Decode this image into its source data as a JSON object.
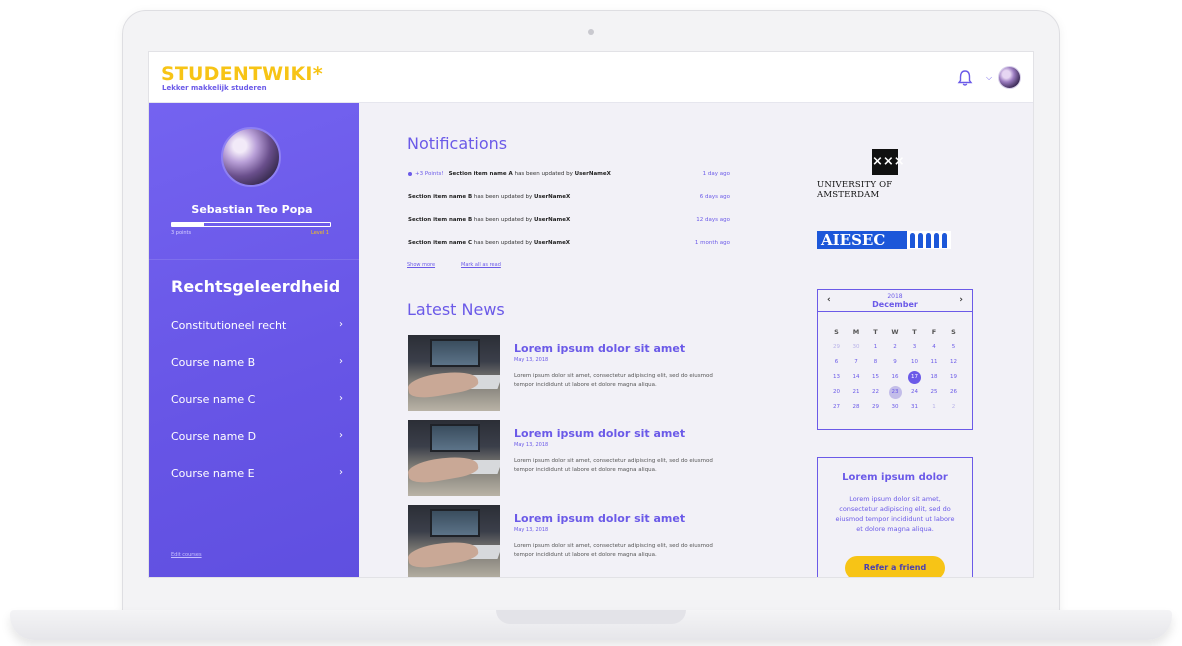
{
  "header": {
    "logo": "STUDENTWIKI*",
    "tagline": "Lekker makkelijk studeren"
  },
  "sidebar": {
    "user_name": "Sebastian Teo Popa",
    "points": "3 points",
    "level": "Level 1",
    "progress_fraction": 0.2,
    "faculty": "Rechtsgeleerdheid",
    "courses": [
      {
        "label": "Constitutioneel recht"
      },
      {
        "label": "Course name B"
      },
      {
        "label": "Course name C"
      },
      {
        "label": "Course name D"
      },
      {
        "label": "Course name E"
      }
    ],
    "edit_courses": "Edit courses"
  },
  "notifications": {
    "title": "Notifications",
    "items": [
      {
        "points": "+3 Points!",
        "item": "Section item name A",
        "text": "has been updated by",
        "user": "UserNameX",
        "time": "1 day ago"
      },
      {
        "points": "",
        "item": "Section item name B",
        "text": "has been updated by",
        "user": "UserNameX",
        "time": "6 days ago"
      },
      {
        "points": "",
        "item": "Section item name B",
        "text": "has been updated by",
        "user": "UserNameX",
        "time": "12 days ago"
      },
      {
        "points": "",
        "item": "Section item name C",
        "text": "has been updated by",
        "user": "UserNameX",
        "time": "1 month ago"
      }
    ],
    "show_more": "Show more",
    "mark_all_read": "Mark all as read"
  },
  "news": {
    "title": "Latest News",
    "items": [
      {
        "title": "Lorem ipsum dolor sit amet",
        "date": "May 13, 2018",
        "body": "Lorem ipsum dolor sit amet, consectetur adipiscing elit, sed do eiusmod tempor incididunt ut labore et dolore magna aliqua."
      },
      {
        "title": "Lorem ipsum dolor sit amet",
        "date": "May 13, 2018",
        "body": "Lorem ipsum dolor sit amet, consectetur adipiscing elit, sed do eiusmod tempor incididunt ut labore et dolore magna aliqua."
      },
      {
        "title": "Lorem ipsum dolor sit amet",
        "date": "May 13, 2018",
        "body": "Lorem ipsum dolor sit amet, consectetur adipiscing elit, sed do eiusmod tempor incididunt ut labore et dolore magna aliqua."
      }
    ]
  },
  "partners": {
    "uva_mark": "⨯⨯⨯",
    "uva_name": "UNIVERSITY OF AMSTERDAM",
    "aiesec_name": "AIESEC"
  },
  "calendar": {
    "year": "2018",
    "month": "December",
    "weekdays": [
      "S",
      "M",
      "T",
      "W",
      "T",
      "F",
      "S"
    ],
    "days": [
      {
        "d": "29",
        "s": "muted"
      },
      {
        "d": "30",
        "s": "muted"
      },
      {
        "d": "1",
        "s": ""
      },
      {
        "d": "2",
        "s": ""
      },
      {
        "d": "3",
        "s": ""
      },
      {
        "d": "4",
        "s": ""
      },
      {
        "d": "5",
        "s": ""
      },
      {
        "d": "6",
        "s": ""
      },
      {
        "d": "7",
        "s": ""
      },
      {
        "d": "8",
        "s": ""
      },
      {
        "d": "9",
        "s": ""
      },
      {
        "d": "10",
        "s": ""
      },
      {
        "d": "11",
        "s": ""
      },
      {
        "d": "12",
        "s": ""
      },
      {
        "d": "13",
        "s": ""
      },
      {
        "d": "14",
        "s": ""
      },
      {
        "d": "15",
        "s": ""
      },
      {
        "d": "16",
        "s": ""
      },
      {
        "d": "17",
        "s": "today"
      },
      {
        "d": "18",
        "s": ""
      },
      {
        "d": "19",
        "s": ""
      },
      {
        "d": "20",
        "s": ""
      },
      {
        "d": "21",
        "s": ""
      },
      {
        "d": "22",
        "s": ""
      },
      {
        "d": "23",
        "s": "marked"
      },
      {
        "d": "24",
        "s": ""
      },
      {
        "d": "25",
        "s": ""
      },
      {
        "d": "26",
        "s": ""
      },
      {
        "d": "27",
        "s": ""
      },
      {
        "d": "28",
        "s": ""
      },
      {
        "d": "29",
        "s": ""
      },
      {
        "d": "30",
        "s": ""
      },
      {
        "d": "31",
        "s": ""
      },
      {
        "d": "1",
        "s": "muted"
      },
      {
        "d": "2",
        "s": "muted"
      }
    ]
  },
  "refer": {
    "title": "Lorem ipsum dolor",
    "body": "Lorem ipsum dolor sit amet, consectetur adipiscing elit, sed do eiusmod tempor incididunt ut labore et dolore magna aliqua.",
    "button": "Refer a friend"
  },
  "colors": {
    "accent": "#6b5ae8",
    "brand_yellow": "#f7c416",
    "sidebar": "#6755e6"
  }
}
